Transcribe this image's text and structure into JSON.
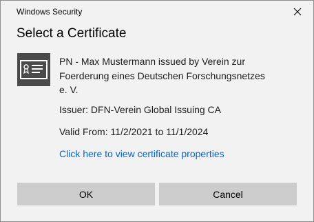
{
  "window": {
    "title": "Windows Security"
  },
  "heading": "Select a Certificate",
  "certificate": {
    "icon": "certificate-icon",
    "name": "PN - Max Mustermann issued by Verein zur Foerderung eines Deutschen Forschungsnetzes e. V.",
    "issuer": "Issuer: DFN-Verein Global Issuing CA",
    "valid": "Valid From: 11/2/2021 to 11/1/2024",
    "properties_link": "Click here to view certificate properties"
  },
  "buttons": {
    "ok_label": "OK",
    "cancel_label": "Cancel"
  },
  "colors": {
    "dialog_background": "#f2f2f2",
    "link": "#0066cc",
    "button_background": "#cccccc",
    "icon_background": "#4a4a4a"
  }
}
